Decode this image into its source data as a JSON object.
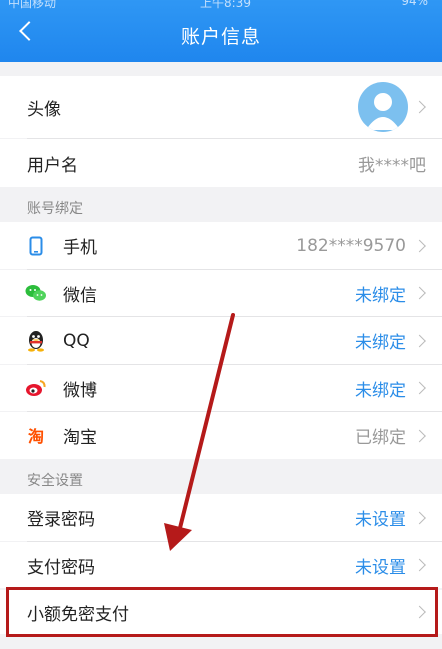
{
  "status_bar": {
    "carrier": "中国移动",
    "time": "上午8:39",
    "battery": "94%"
  },
  "header": {
    "title": "账户信息"
  },
  "profile": {
    "avatar_label": "头像",
    "username_label": "用户名",
    "username_value": "我****吧"
  },
  "binding": {
    "section_label": "账号绑定",
    "items": [
      {
        "label": "手机",
        "value": "182****9570",
        "status": "neutral"
      },
      {
        "label": "微信",
        "value": "未绑定",
        "status": "blue"
      },
      {
        "label": "QQ",
        "value": "未绑定",
        "status": "blue"
      },
      {
        "label": "微博",
        "value": "未绑定",
        "status": "blue"
      },
      {
        "label": "淘宝",
        "value": "已绑定",
        "status": "neutral"
      }
    ]
  },
  "security": {
    "section_label": "安全设置",
    "items": [
      {
        "label": "登录密码",
        "value": "未设置"
      },
      {
        "label": "支付密码",
        "value": "未设置"
      },
      {
        "label": "小额免密支付",
        "value": ""
      }
    ]
  },
  "colors": {
    "accent": "#1f86ee",
    "link": "#2b8de8",
    "annotation": "#b51a1a"
  }
}
